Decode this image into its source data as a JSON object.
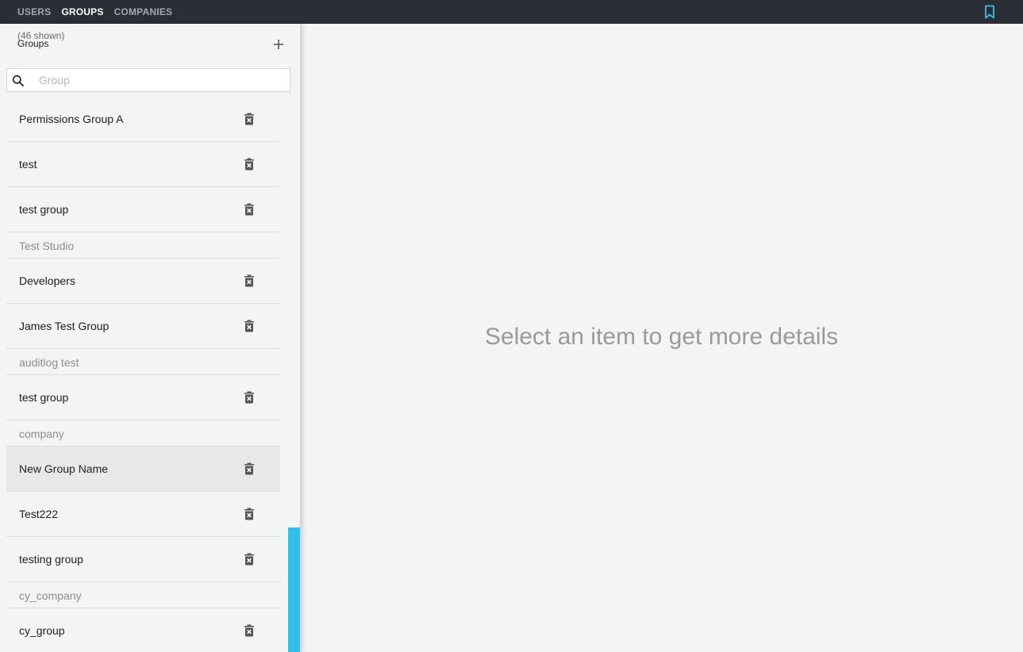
{
  "nav": {
    "tabs": [
      {
        "label": "USERS",
        "active": false
      },
      {
        "label": "GROUPS",
        "active": true
      },
      {
        "label": "COMPANIES",
        "active": false
      }
    ],
    "accent_color": "#2fbfec",
    "bookmark_icon": "bookmark-icon"
  },
  "sidebar": {
    "count_text": "(46 shown)",
    "title": "Groups",
    "add_icon": "plus-icon",
    "search": {
      "placeholder": "Group",
      "value": ""
    },
    "rows": [
      {
        "type": "item",
        "label": "Permissions Group A"
      },
      {
        "type": "item",
        "label": "test"
      },
      {
        "type": "item",
        "label": "test group"
      },
      {
        "type": "company",
        "label": "Test Studio"
      },
      {
        "type": "item",
        "label": "Developers"
      },
      {
        "type": "item",
        "label": "James Test Group"
      },
      {
        "type": "company",
        "label": "auditlog test"
      },
      {
        "type": "item",
        "label": "test group"
      },
      {
        "type": "company",
        "label": "company"
      },
      {
        "type": "item",
        "label": "New Group Name",
        "selected": true
      },
      {
        "type": "item",
        "label": "Test222"
      },
      {
        "type": "item",
        "label": "testing group"
      },
      {
        "type": "company",
        "label": "cy_company"
      },
      {
        "type": "item",
        "label": "cy_group"
      }
    ]
  },
  "main": {
    "empty_message": "Select an item to get more details"
  }
}
